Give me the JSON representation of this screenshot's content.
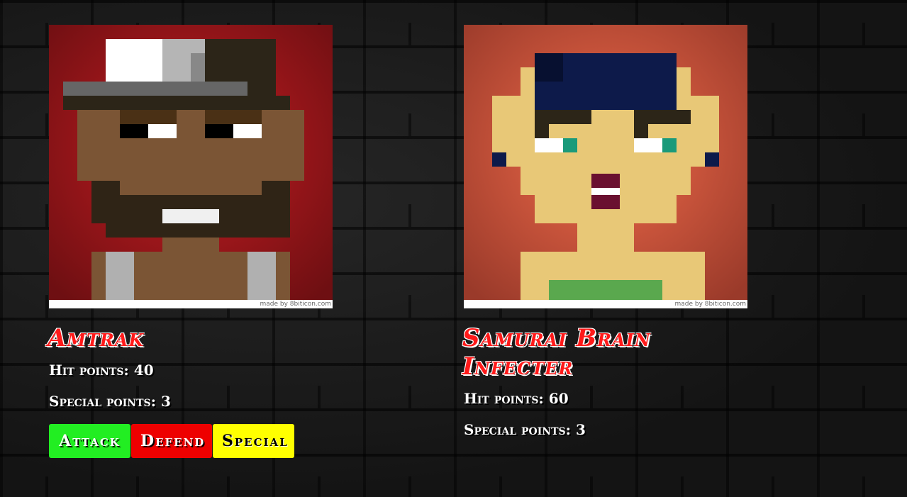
{
  "player": {
    "name": "Amtrak",
    "hp_label": "Hit points:",
    "hp": "40",
    "sp_label": "Special points:",
    "sp": "3",
    "credit": "made by 8biticon.com",
    "portrait_icon": "pixel-avatar-man-white-cap"
  },
  "enemy": {
    "name": "Samurai Brain Infecter",
    "hp_label": "Hit points:",
    "hp": "60",
    "sp_label": "Special points:",
    "sp": "3",
    "credit": "made by 8biticon.com",
    "portrait_icon": "pixel-avatar-woman-navy-hat"
  },
  "actions": {
    "attack": "Attack",
    "defend": "Defend",
    "special": "Special"
  },
  "colors": {
    "attack": "#22ee22",
    "defend": "#ee0000",
    "special": "#ffff00",
    "name_red": "#ff1a1a"
  }
}
